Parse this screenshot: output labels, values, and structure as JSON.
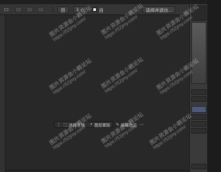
{
  "options_bar": {
    "field_left": "目",
    "field_mid": "1 ✓",
    "checkbox_label": "自",
    "field_right": "选择并遮住..."
  },
  "float_toolbar": {
    "btn1": "选择主体",
    "btn2": "图层蒙版",
    "btn3": "编辑选区"
  },
  "watermarks": [
    {
      "line1": "图片资源会小籁论坛",
      "line2": "https://52jmy.com/"
    },
    {
      "line1": "图片资源会小籁论坛",
      "line2": "https://52jmy.com/"
    },
    {
      "line1": "图片资源会小籁论坛",
      "line2": "https://52jmy.com/"
    },
    {
      "line1": "图片资源会小籁论坛",
      "line2": "https://52jmy.com/"
    },
    {
      "line1": "图片资源会小籁论坛",
      "line2": "https://52jmy.com/"
    },
    {
      "line1": "图片资源会小籁论坛",
      "line2": "https://52jmy.com/"
    },
    {
      "line1": "图片资源会小籁论坛",
      "line2": "https://52jmy.com/"
    },
    {
      "line1": "图片资源会小籁论坛",
      "line2": "https://52jmy.com/"
    },
    {
      "line1": "图片资源会小籁论坛",
      "line2": "https://52jmy.com/"
    }
  ]
}
